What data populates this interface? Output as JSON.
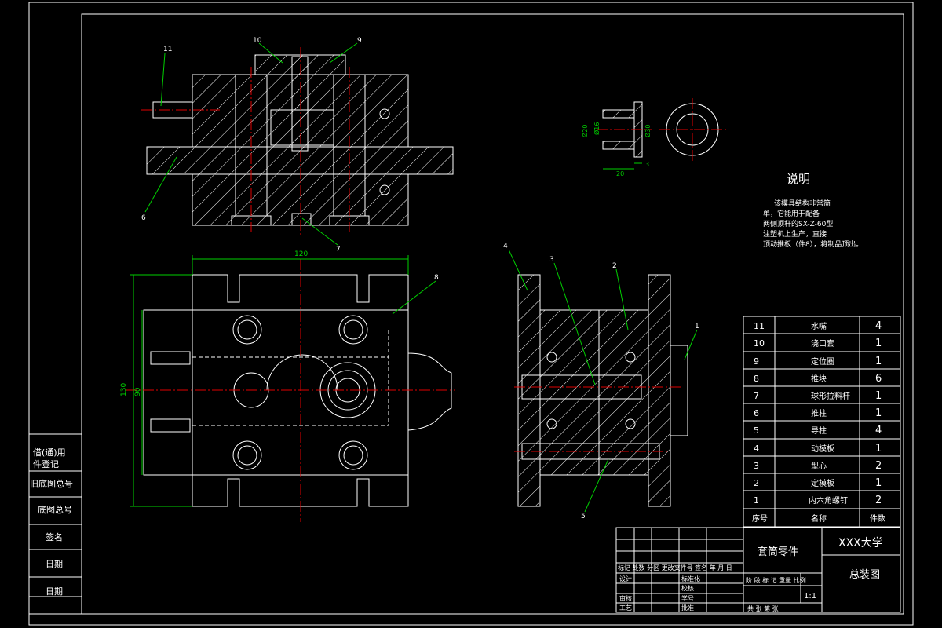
{
  "balloons": [
    "11",
    "10",
    "9",
    "6",
    "7",
    "8",
    "4",
    "3",
    "2",
    "1",
    "5"
  ],
  "dimensions": {
    "d20": "Ø20",
    "d16": "Ø16",
    "d30": "Ø30",
    "len20": "20",
    "len3": "3",
    "w120": "120",
    "h130": "130",
    "h90": "90"
  },
  "notes": {
    "title": "说明",
    "lines": [
      "该模具结构非常简",
      "单，它能用于配备",
      "两侧顶杆的SX-Z-60型",
      "注塑机上生产，直接",
      "顶动推板（件8），将制品顶出。"
    ]
  },
  "parts_list": {
    "rows": [
      {
        "no": "11",
        "name": "水嘴",
        "qty": "4"
      },
      {
        "no": "10",
        "name": "浇口套",
        "qty": "1"
      },
      {
        "no": "9",
        "name": "定位圈",
        "qty": "1"
      },
      {
        "no": "8",
        "name": "推块",
        "qty": "6"
      },
      {
        "no": "7",
        "name": "球形拉料杆",
        "qty": "1"
      },
      {
        "no": "6",
        "name": "推柱",
        "qty": "1"
      },
      {
        "no": "5",
        "name": "导柱",
        "qty": "4"
      },
      {
        "no": "4",
        "name": "动模板",
        "qty": "1"
      },
      {
        "no": "3",
        "name": "型心",
        "qty": "2"
      },
      {
        "no": "2",
        "name": "定模板",
        "qty": "1"
      },
      {
        "no": "1",
        "name": "内六角螺钉",
        "qty": "2"
      }
    ],
    "header": {
      "no": "序号",
      "name": "名称",
      "qty": "件数"
    }
  },
  "title_block": {
    "part_name": "套筒零件",
    "school": "XXX大学",
    "drawing_name": "总装图",
    "revision_row": "标记 处数 分区 更改文件号 签名 年 月 日",
    "design": "设计",
    "standardize": "标准化",
    "review": "审核",
    "process": "工艺",
    "proofread": "校核",
    "student_id": "学号",
    "approve": "批准",
    "stage_labels": "阶 段 标 记 重量 比例",
    "scale": "1:1",
    "sheet": "共 张 第 张"
  },
  "side_panel": {
    "labels": [
      "借(通)用",
      "件登记",
      "旧底图总号",
      "底图总号",
      "签名",
      "日期",
      "日期"
    ]
  }
}
